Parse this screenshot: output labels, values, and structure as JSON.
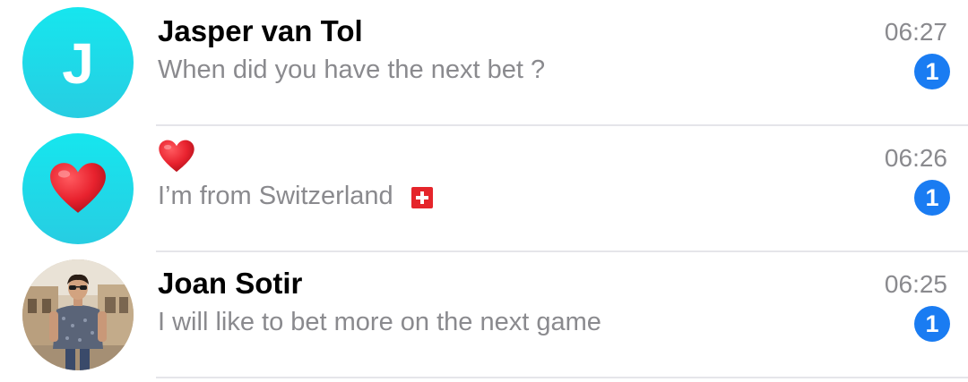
{
  "chats": [
    {
      "avatar_letter": "J",
      "name": "Jasper van Tol",
      "preview": "When did you have the next bet ?",
      "time": "06:27",
      "unread_count": "1"
    },
    {
      "avatar_icon": "red-heart-icon",
      "name_icon": "red-heart-icon",
      "preview": "I’m from Switzerland",
      "preview_icon": "swiss-flag-icon",
      "time": "06:26",
      "unread_count": "1"
    },
    {
      "avatar_icon": "user-photo",
      "name": "Joan Sotir",
      "preview": "I will like to bet more on the next game",
      "time": "06:25",
      "unread_count": "1"
    }
  ],
  "colors": {
    "avatar_gradient_top": "#16e6ee",
    "avatar_gradient_bottom": "#27cde2",
    "badge": "#1a7cf2",
    "secondary_text": "#8a8a8e",
    "heart": "#e8222e",
    "flag_red": "#e5252b"
  }
}
